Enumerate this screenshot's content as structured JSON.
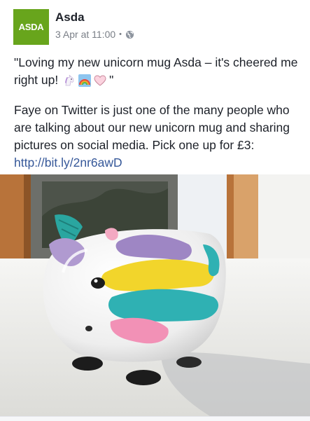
{
  "post": {
    "page_name": "Asda",
    "avatar_logo_text": "ASDA",
    "date": "3 Apr at 11:00",
    "separator": "•",
    "privacy_icon": "globe-icon",
    "quote_text": "\"Loving my new unicorn mug Asda – it's cheered me right up! ",
    "quote_emojis": [
      "unicorn-emoji",
      "rainbow-emoji",
      "heart-emoji"
    ],
    "quote_end": "\"",
    "body_text": "Faye on Twitter is just one of the many people who are talking about our new unicorn mug and sharing pictures on social media. Pick one up for £3: ",
    "link_text": "http://bit.ly/2nr6awD",
    "photo_subject": "unicorn mug on windowsill"
  },
  "colors": {
    "brand_green": "#68a51c",
    "link": "#365899",
    "meta": "#7a7f87"
  }
}
